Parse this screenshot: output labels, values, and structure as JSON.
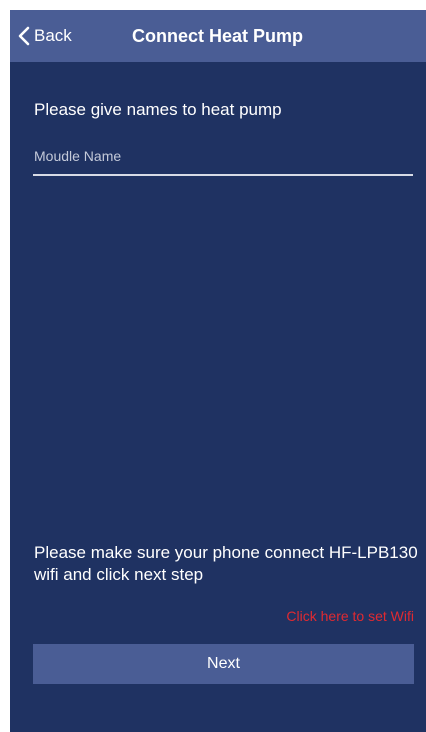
{
  "navbar": {
    "back_label": "Back",
    "title": "Connect Heat Pump"
  },
  "form": {
    "prompt": "Please give names to heat pump",
    "name_placeholder": "Moudle Name",
    "name_value": ""
  },
  "footer": {
    "info": "Please make sure your phone connect HF-LPB130 wifi and click next step",
    "wifi_link": "Click here to set Wifi",
    "next_label": "Next"
  },
  "icons": {
    "back": "chevron-left-icon"
  },
  "colors": {
    "background": "#1f3262",
    "navbar": "#4a5d95",
    "button": "#4a5d95",
    "link": "#e02a31",
    "text": "#ffffff"
  }
}
